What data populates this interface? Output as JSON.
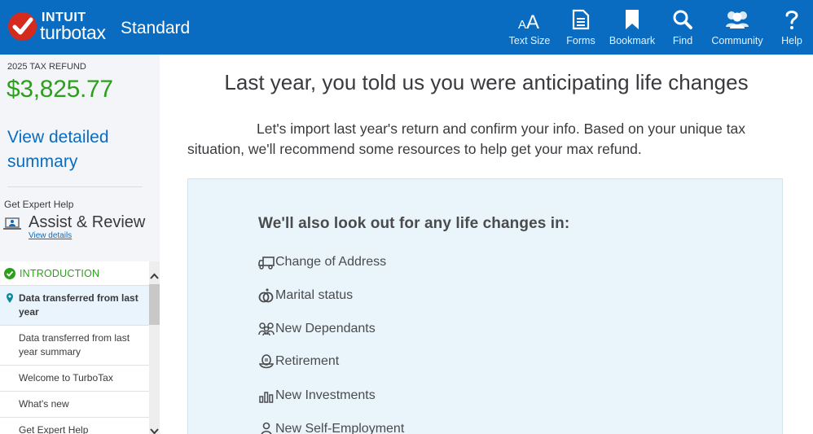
{
  "header": {
    "brand_top": "INTUIT",
    "brand_bottom": "turbotax",
    "edition": "Standard",
    "nav": [
      {
        "label": "Text Size",
        "icon": "text-size-icon"
      },
      {
        "label": "Forms",
        "icon": "forms-icon"
      },
      {
        "label": "Bookmark",
        "icon": "bookmark-icon"
      },
      {
        "label": "Find",
        "icon": "search-icon"
      },
      {
        "label": "Community",
        "icon": "community-icon"
      },
      {
        "label": "Help",
        "icon": "help-icon"
      }
    ]
  },
  "sidebar": {
    "refund_label": "2025 TAX REFUND",
    "refund_amount": "$3,825.77",
    "view_summary": "View detailed summary",
    "expert_label": "Get Expert Help",
    "assist_title": "Assist & Review",
    "assist_link": "View details",
    "section_label": "INTRODUCTION",
    "items": [
      {
        "label": "Data transferred from last year",
        "active": true
      },
      {
        "label": "Data transferred from last year summary",
        "active": false
      },
      {
        "label": "Welcome to TurboTax",
        "active": false
      },
      {
        "label": "What's new",
        "active": false
      },
      {
        "label": "Get Expert Help",
        "active": false
      }
    ]
  },
  "main": {
    "title": "Last year, you told us you were anticipating life changes",
    "intro": "Let's import last year's return and confirm your info. Based on your unique tax situation, we'll recommend some resources to help get your max refund.",
    "panel_title": "We'll also look out for any life changes in:",
    "changes": [
      {
        "label": "Change of Address",
        "icon": "truck-icon"
      },
      {
        "label": "Marital status",
        "icon": "rings-icon"
      },
      {
        "label": "New Dependants",
        "icon": "family-icon"
      },
      {
        "label": "Retirement",
        "icon": "nest-egg-icon"
      },
      {
        "label": "New Investments",
        "icon": "bar-chart-icon"
      },
      {
        "label": "New Self-Employment",
        "icon": "person-icon"
      }
    ]
  },
  "colors": {
    "header_blue": "#0a6cc1",
    "refund_green": "#2ca01c",
    "logo_red": "#d52b1e",
    "panel_bg": "#eaf5fb"
  }
}
